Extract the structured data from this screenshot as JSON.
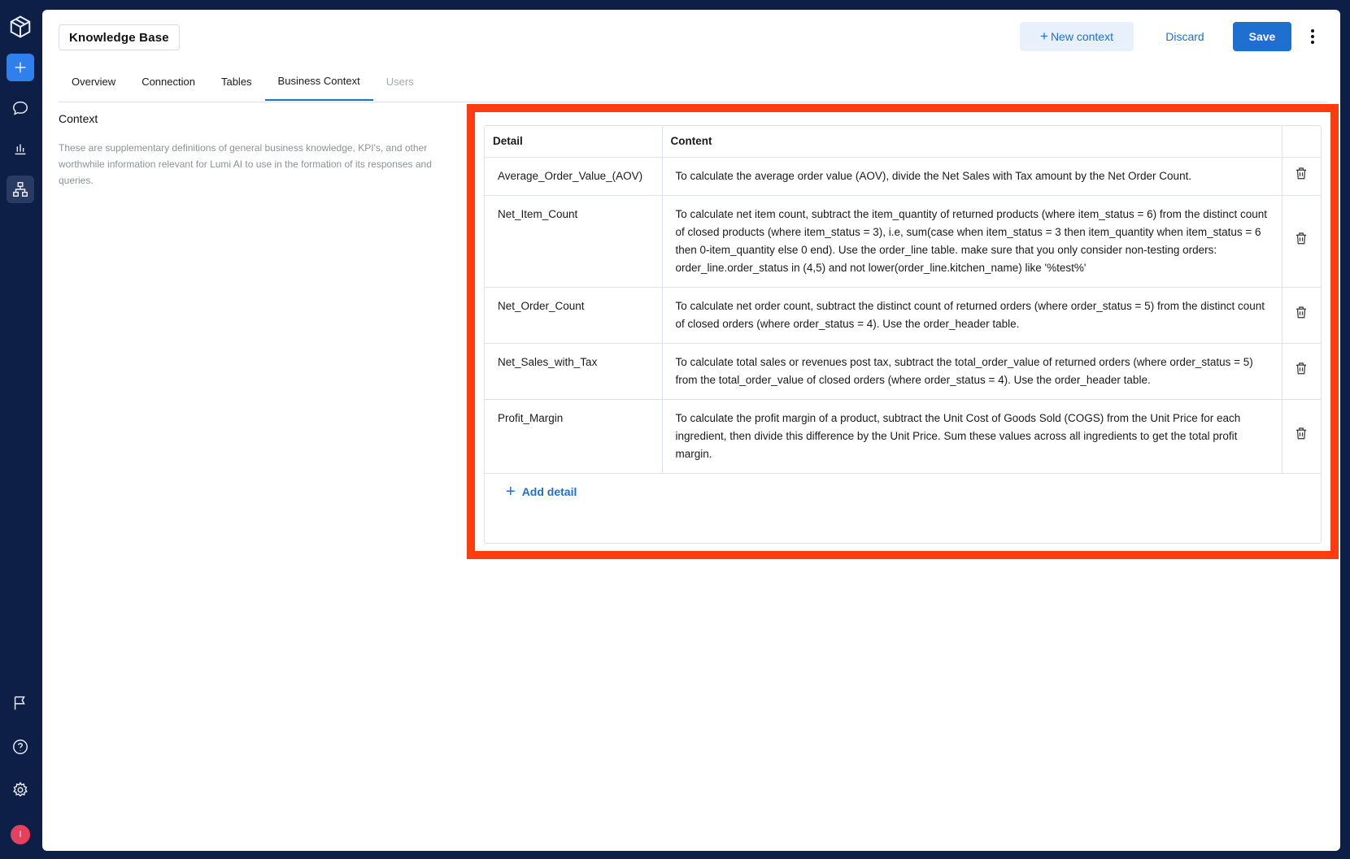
{
  "sidebar": {
    "items": [
      "logo-icon",
      "plus-icon",
      "chat-icon",
      "chart-icon",
      "org-chart-icon",
      "flag-icon",
      "help-icon",
      "settings-icon"
    ],
    "avatar_initial": "I"
  },
  "header": {
    "title": "Knowledge Base",
    "new_context_label": "New context",
    "new_context_prefix": "+",
    "discard_label": "Discard",
    "save_label": "Save"
  },
  "tabs": [
    {
      "label": "Overview",
      "state": "normal"
    },
    {
      "label": "Connection",
      "state": "normal"
    },
    {
      "label": "Tables",
      "state": "normal"
    },
    {
      "label": "Business Context",
      "state": "active"
    },
    {
      "label": "Users",
      "state": "disabled"
    }
  ],
  "context": {
    "title": "Context",
    "description": "These are supplementary definitions of general business knowledge, KPI's, and other worthwhile information relevant for Lumi AI to use in the formation of its responses and queries."
  },
  "table": {
    "headers": {
      "detail": "Detail",
      "content": "Content"
    },
    "rows": [
      {
        "detail": "Average_Order_Value_(AOV)",
        "content": "To calculate the average order value (AOV), divide the Net Sales with Tax amount by the Net Order Count."
      },
      {
        "detail": "Net_Item_Count",
        "content": "To calculate net item count, subtract the item_quantity of returned products (where item_status = 6) from the distinct count of closed products (where item_status = 3), i.e, sum(case when item_status = 3 then item_quantity when item_status = 6 then 0-item_quantity else 0 end). Use the order_line table. make sure that you only consider non-testing orders: order_line.order_status in (4,5) and not lower(order_line.kitchen_name) like '%test%'"
      },
      {
        "detail": "Net_Order_Count",
        "content": "To calculate net order count, subtract the distinct count of returned orders (where order_status = 5) from the distinct count of closed orders (where order_status = 4). Use the order_header table."
      },
      {
        "detail": "Net_Sales_with_Tax",
        "content": "To calculate total sales or revenues post tax, subtract the total_order_value of returned orders (where order_status = 5) from the total_order_value of closed orders (where order_status = 4). Use the order_header table."
      },
      {
        "detail": "Profit_Margin",
        "content": "To calculate the profit margin of a product, subtract the Unit Cost of Goods Sold (COGS) from the Unit Price for each ingredient, then divide this difference by the Unit Price. Sum these values across all ingredients to get the total profit margin."
      }
    ],
    "add_label": "Add detail",
    "add_prefix": "+"
  },
  "colors": {
    "sidebar_bg": "#0d1f47",
    "accent": "#1f6fd1",
    "highlight": "#ff3b0f",
    "avatar": "#e5405e"
  }
}
